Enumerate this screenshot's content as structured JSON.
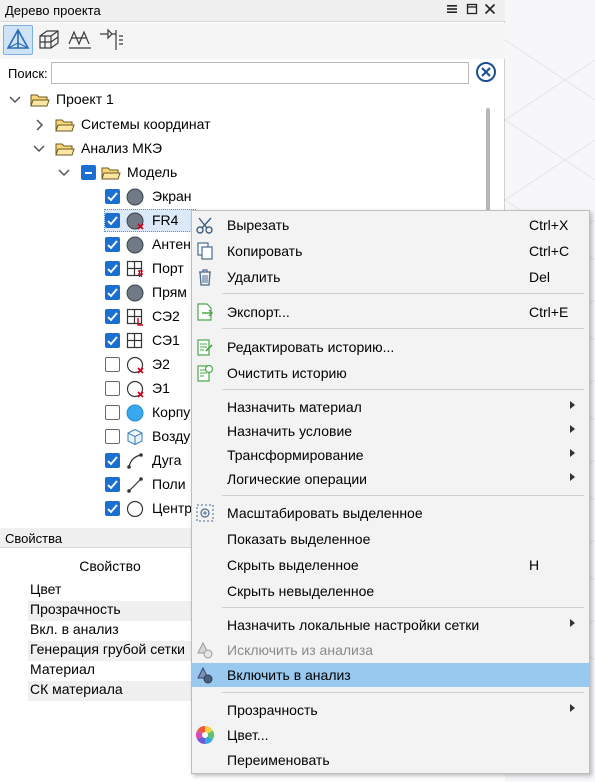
{
  "project_tree": {
    "title": "Дерево проекта",
    "search_label": "Поиск:",
    "search_value": "",
    "nodes": {
      "project": "Проект 1",
      "coord_systems": "Системы координат",
      "fem_analysis": "Анализ МКЭ",
      "model": "Модель",
      "screen": "Экран",
      "fr4": "FR4",
      "antenna": "Антен",
      "port": "Порт",
      "rect": "Прям",
      "se2": "СЭ2",
      "se1": "СЭ1",
      "e2": "Э2",
      "e1": "Э1",
      "body": "Корпу",
      "air": "Возду",
      "arc": "Дуга",
      "poly": "Поли",
      "center": "Центр"
    }
  },
  "properties": {
    "title": "Свойства",
    "column_header": "Свойство",
    "rows": [
      "Цвет",
      "Прозрачность",
      "Вкл. в анализ",
      "Генерация грубой сетки",
      "Материал",
      "СК материала"
    ]
  },
  "context_menu": {
    "cut": {
      "label": "Вырезать",
      "shortcut": "Ctrl+X"
    },
    "copy": {
      "label": "Копировать",
      "shortcut": "Ctrl+C"
    },
    "delete": {
      "label": "Удалить",
      "shortcut": "Del"
    },
    "export": {
      "label": "Экспорт...",
      "shortcut": "Ctrl+E"
    },
    "edit_history": {
      "label": "Редактировать историю..."
    },
    "clear_history": {
      "label": "Очистить историю"
    },
    "assign_material": {
      "label": "Назначить материал"
    },
    "assign_condition": {
      "label": "Назначить условие"
    },
    "transform": {
      "label": "Трансформирование"
    },
    "logic_ops": {
      "label": "Логические операции"
    },
    "zoom_selected": {
      "label": "Масштабировать выделенное"
    },
    "show_selected": {
      "label": "Показать выделенное"
    },
    "hide_selected": {
      "label": "Скрыть выделенное",
      "shortcut": "H"
    },
    "hide_unselected": {
      "label": "Скрыть невыделенное"
    },
    "local_mesh": {
      "label": "Назначить локальные настройки сетки"
    },
    "exclude_analysis": {
      "label": "Исключить из анализа"
    },
    "include_analysis": {
      "label": "Включить в анализ"
    },
    "transparency": {
      "label": "Прозрачность"
    },
    "color": {
      "label": "Цвет..."
    },
    "rename": {
      "label": "Переименовать"
    }
  },
  "colors": {
    "accent": "#1a6fd1",
    "highlight": "#99c9ef",
    "selection": "#dbe9f9"
  }
}
